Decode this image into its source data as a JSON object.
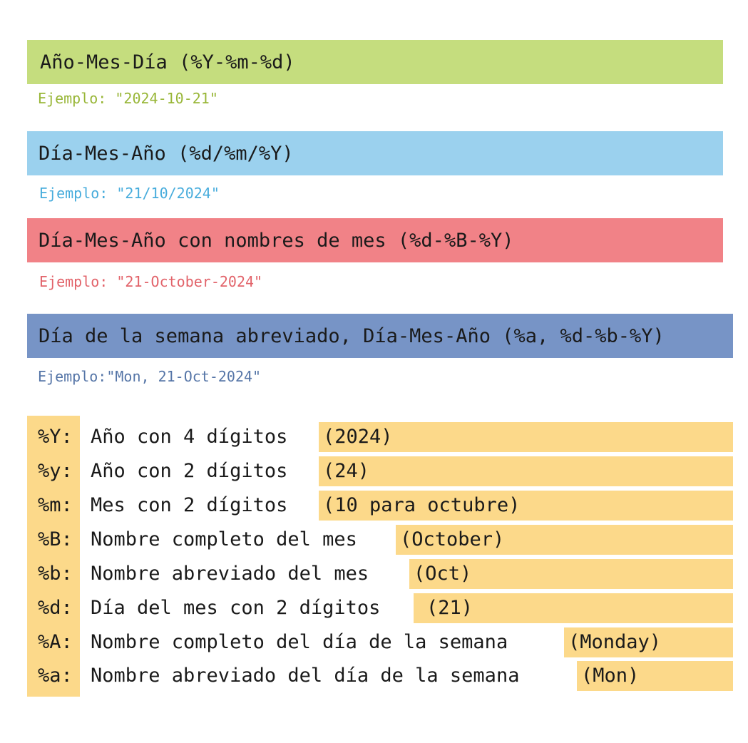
{
  "formats": [
    {
      "label": "Año-Mes-Día (%Y-%m-%d)",
      "example": "Ejemplo: \"2024-10-21\"",
      "color": "#c5dd7e",
      "example_color": "#98b637"
    },
    {
      "label": "Día-Mes-Año (%d/%m/%Y)",
      "example": "Ejemplo: \"21/10/2024\"",
      "color": "#9bd1ee",
      "example_color": "#47acdc"
    },
    {
      "label": "Día-Mes-Año con nombres de mes (%d-%B-%Y)",
      "example": "Ejemplo: \"21-October-2024\"",
      "color": "#f18287",
      "example_color": "#e2636a"
    },
    {
      "label": "Día de la semana abreviado, Día-Mes-Año (%a, %d-%b-%Y)",
      "example": "Ejemplo:\"Mon, 21-Oct-2024\"",
      "color": "#7794c6",
      "example_color": "#5575a7"
    }
  ],
  "reference": {
    "highlight_color": "#fcd98a",
    "items": [
      {
        "code": "%Y:",
        "description": "Año con 4 dígitos",
        "example": "(2024)"
      },
      {
        "code": "%y:",
        "description": "Año con 2 dígitos",
        "example": "(24)"
      },
      {
        "code": "%m:",
        "description": "Mes con 2 dígitos",
        "example": "(10 para octubre)"
      },
      {
        "code": "%B:",
        "description": "Nombre completo del mes",
        "example": "(October)"
      },
      {
        "code": "%b:",
        "description": "Nombre abreviado del mes",
        "example": "(Oct)"
      },
      {
        "code": "%d:",
        "description": "Día del mes con 2 dígitos",
        "example": "(21)"
      },
      {
        "code": "%A:",
        "description": "Nombre completo del día de la semana",
        "example": "(Monday)"
      },
      {
        "code": "%a:",
        "description": "Nombre abreviado del día de la semana",
        "example": "(Mon)"
      }
    ]
  }
}
